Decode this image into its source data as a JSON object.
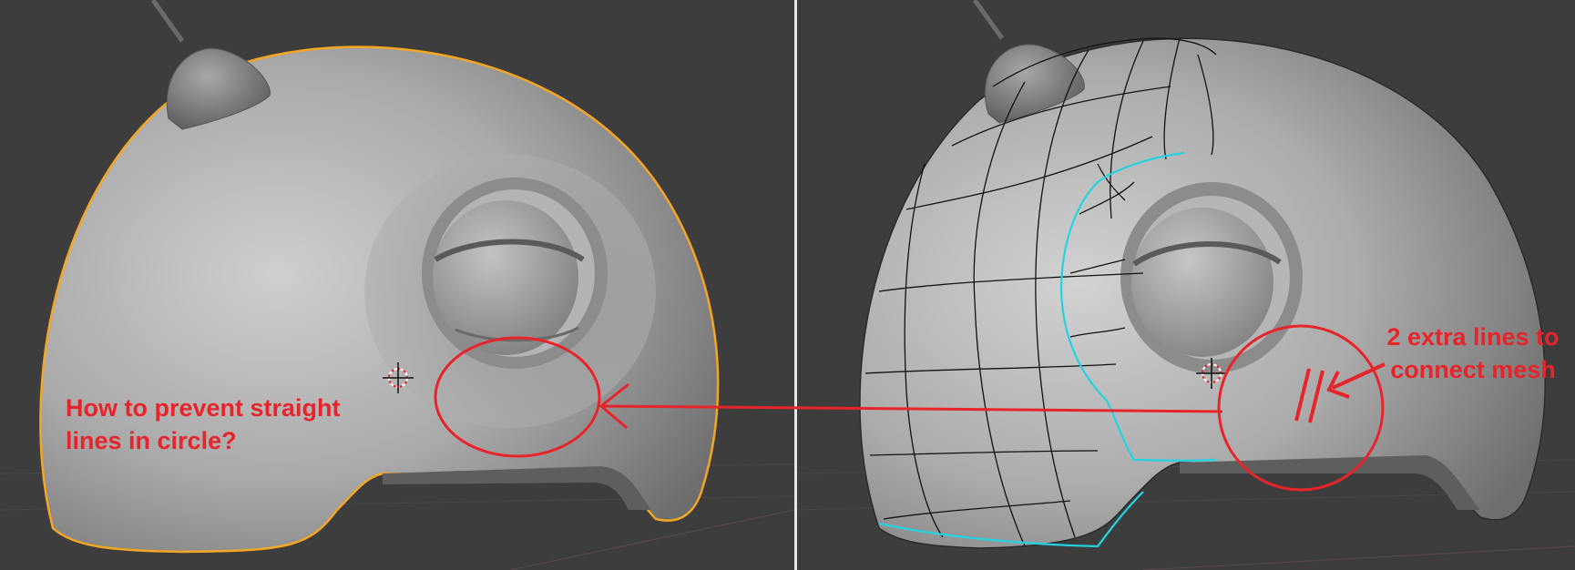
{
  "viewports": {
    "left": {
      "mode": "object-mode-smooth-render"
    },
    "right": {
      "mode": "edit-mode-wireframe"
    }
  },
  "annotations": {
    "question": "How to prevent straight\nlines in circle?",
    "note": "2 extra lines to\nconnect mesh"
  },
  "colors": {
    "background": "#3d3d3d",
    "selection_outline": "#f5a623",
    "edge_select": "#22d3e0",
    "annotation": "#e8242b",
    "divider": "#e8e8e8"
  }
}
